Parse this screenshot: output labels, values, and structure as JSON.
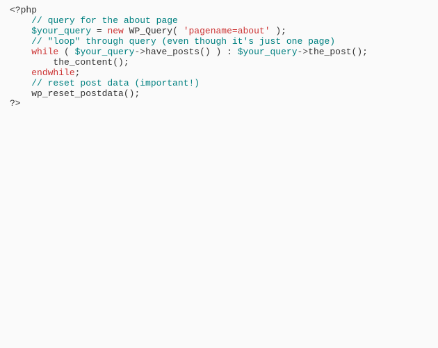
{
  "code": {
    "line1": {
      "open_tag": "<?php"
    },
    "line2": {
      "indent": "    ",
      "comment": "// query for the about page"
    },
    "line3": {
      "indent": "    ",
      "var": "$your_query",
      "assign": " = ",
      "new_kw": "new",
      "class_call": " WP_Query( ",
      "string_arg": "'pagename=about'",
      "close": " );"
    },
    "line4": {
      "indent": "    ",
      "comment": "// \"loop\" through query (even though it's just one page)"
    },
    "line5": {
      "indent": "    ",
      "while_kw": "while",
      "open_paren": " ( ",
      "var1": "$your_query",
      "arrow1": "->",
      "have_posts": "have_posts() ) : ",
      "var2": "$your_query",
      "arrow2": "->",
      "the_post": "the_post();"
    },
    "line6": {
      "indent": "        ",
      "content": "the_content();"
    },
    "line7": {
      "indent": "    ",
      "endwhile_kw": "endwhile",
      "semi": ";"
    },
    "line8": {
      "indent": "    ",
      "comment": "// reset post data (important!)"
    },
    "line9": {
      "indent": "    ",
      "reset": "wp_reset_postdata();"
    },
    "line10": {
      "close_tag": "?>"
    }
  }
}
